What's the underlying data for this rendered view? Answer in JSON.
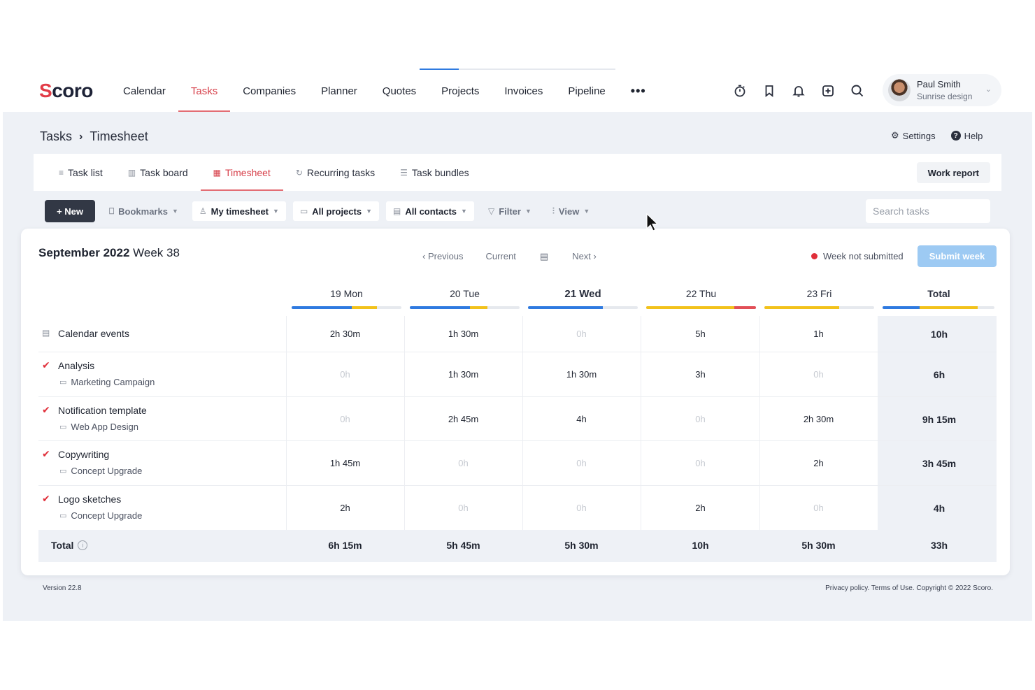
{
  "nav": {
    "logo": "Scoro",
    "items": [
      "Calendar",
      "Tasks",
      "Companies",
      "Planner",
      "Quotes",
      "Projects",
      "Invoices",
      "Pipeline"
    ],
    "active": "Tasks",
    "more": "•••",
    "icons": [
      "timer-icon",
      "bookmark-icon",
      "bell-icon",
      "add-square-icon",
      "search-icon"
    ],
    "user": {
      "name": "Paul Smith",
      "company": "Sunrise design"
    }
  },
  "breadcrumb": {
    "parent": "Tasks",
    "separator": "›",
    "current": "Timesheet"
  },
  "top_actions": {
    "settings": "Settings",
    "help": "Help"
  },
  "tabs": [
    {
      "label": "Task list",
      "icon": "list-icon"
    },
    {
      "label": "Task board",
      "icon": "board-icon"
    },
    {
      "label": "Timesheet",
      "icon": "grid-icon"
    },
    {
      "label": "Recurring tasks",
      "icon": "recurring-icon"
    },
    {
      "label": "Task bundles",
      "icon": "bundles-icon"
    }
  ],
  "active_tab": "Timesheet",
  "work_report": "Work report",
  "filters": {
    "new": "+ New",
    "bookmarks": "Bookmarks",
    "my_timesheet": "My timesheet",
    "all_projects": "All projects",
    "all_contacts": "All contacts",
    "filter": "Filter",
    "view": "View",
    "search_placeholder": "Search tasks"
  },
  "period": {
    "month_year": "September 2022",
    "week": "Week 38"
  },
  "week_nav": {
    "previous": "Previous",
    "current": "Current",
    "next": "Next"
  },
  "week_status": "Week not submitted",
  "submit": "Submit week",
  "days": [
    {
      "label": "19 Mon",
      "bar": [
        {
          "color": "#2f7ae0",
          "pct": 0.55
        },
        {
          "color": "#f2c21b",
          "pct": 0.23
        }
      ]
    },
    {
      "label": "20 Tue",
      "bar": [
        {
          "color": "#2f7ae0",
          "pct": 0.55
        },
        {
          "color": "#f2c21b",
          "pct": 0.16
        }
      ]
    },
    {
      "label": "21 Wed",
      "bar": [
        {
          "color": "#2f7ae0",
          "pct": 0.68
        }
      ]
    },
    {
      "label": "22 Thu",
      "bar": [
        {
          "color": "#f2c21b",
          "pct": 0.8
        },
        {
          "color": "#e24f57",
          "pct": 0.2
        }
      ]
    },
    {
      "label": "23 Fri",
      "bar": [
        {
          "color": "#f2c21b",
          "pct": 0.68
        }
      ]
    }
  ],
  "total_header": {
    "label": "Total",
    "bar": [
      {
        "color": "#2f7ae0",
        "pct": 0.33
      },
      {
        "color": "#f2c21b",
        "pct": 0.52
      }
    ]
  },
  "rows": [
    {
      "name": "Calendar events",
      "project": "",
      "icon": "calendar-icon",
      "values": [
        "2h 30m",
        "1h 30m",
        "0h",
        "5h",
        "1h"
      ],
      "total": "10h"
    },
    {
      "name": "Analysis",
      "project": "Marketing Campaign",
      "icon": "check-icon",
      "values": [
        "0h",
        "1h 30m",
        "1h 30m",
        "3h",
        "0h"
      ],
      "total": "6h"
    },
    {
      "name": "Notification template",
      "project": "Web App Design",
      "icon": "check-icon",
      "values": [
        "0h",
        "2h 45m",
        "4h",
        "0h",
        "2h 30m"
      ],
      "total": "9h 15m"
    },
    {
      "name": "Copywriting",
      "project": "Concept Upgrade",
      "icon": "check-icon",
      "values": [
        "1h 45m",
        "0h",
        "0h",
        "0h",
        "2h"
      ],
      "total": "3h 45m"
    },
    {
      "name": "Logo sketches",
      "project": "Concept Upgrade",
      "icon": "check-icon",
      "values": [
        "2h",
        "0h",
        "0h",
        "2h",
        "0h"
      ],
      "total": "4h"
    }
  ],
  "totals": {
    "label": "Total",
    "values": [
      "6h 15m",
      "5h 45m",
      "5h 30m",
      "10h",
      "5h 30m"
    ],
    "grand": "33h"
  },
  "footer": {
    "version": "Version 22.8",
    "legal": "Privacy policy. Terms of Use. Copyright © 2022 Scoro."
  }
}
